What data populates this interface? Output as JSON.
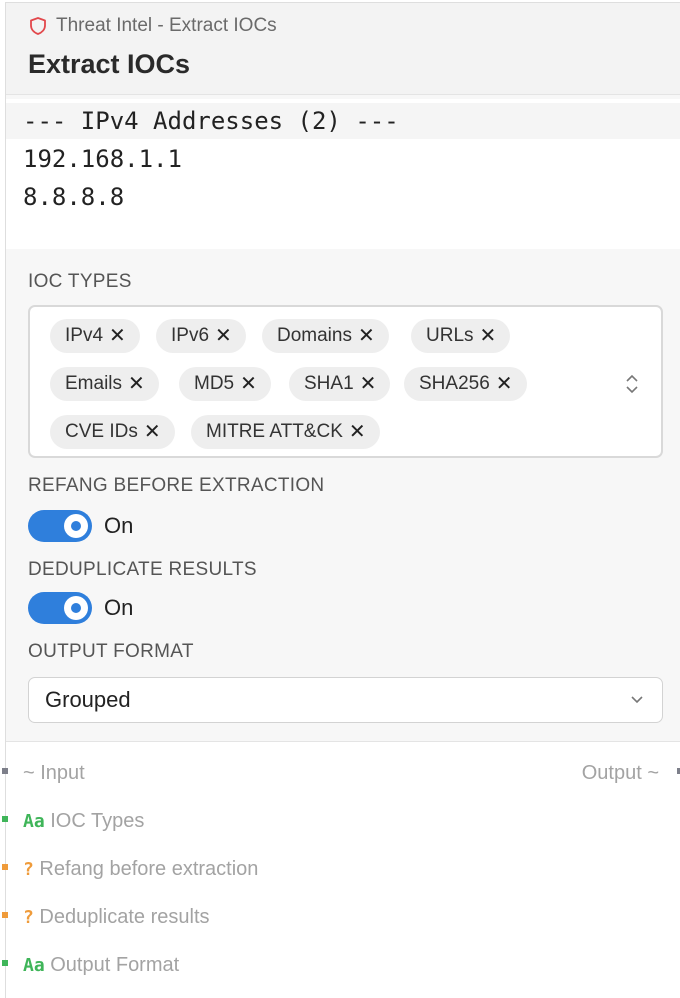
{
  "node": {
    "breadcrumb": "Threat Intel - Extract IOCs",
    "title": "Extract IOCs",
    "accent_color": "#2f7fdc",
    "shield_icon": "shield-icon"
  },
  "output": {
    "lines": [
      "--- IPv4 Addresses (2) ---",
      "192.168.1.1",
      "8.8.8.8"
    ]
  },
  "ioc_types": {
    "label": "IOC TYPES",
    "chips": [
      "IPv4",
      "IPv6",
      "Domains",
      "URLs",
      "Emails",
      "MD5",
      "SHA1",
      "SHA256",
      "CVE IDs",
      "MITRE ATT&CK"
    ],
    "remove_glyph": "✕"
  },
  "refang": {
    "label": "REFANG BEFORE EXTRACTION",
    "state": "On"
  },
  "dedupe": {
    "label": "DEDUPLICATE RESULTS",
    "state": "On"
  },
  "output_format": {
    "label": "OUTPUT FORMAT",
    "value": "Grouped"
  },
  "ports": {
    "input_label": "~ Input",
    "output_label": "Output ~",
    "rows": [
      {
        "type": "Aa",
        "label": "IOC Types",
        "color": "#3fb559"
      },
      {
        "type": "?",
        "label": "Refang before extraction",
        "color": "#ef9b3a"
      },
      {
        "type": "?",
        "label": "Deduplicate results",
        "color": "#ef9b3a"
      },
      {
        "type": "Aa",
        "label": "Output Format",
        "color": "#3fb559"
      }
    ]
  }
}
